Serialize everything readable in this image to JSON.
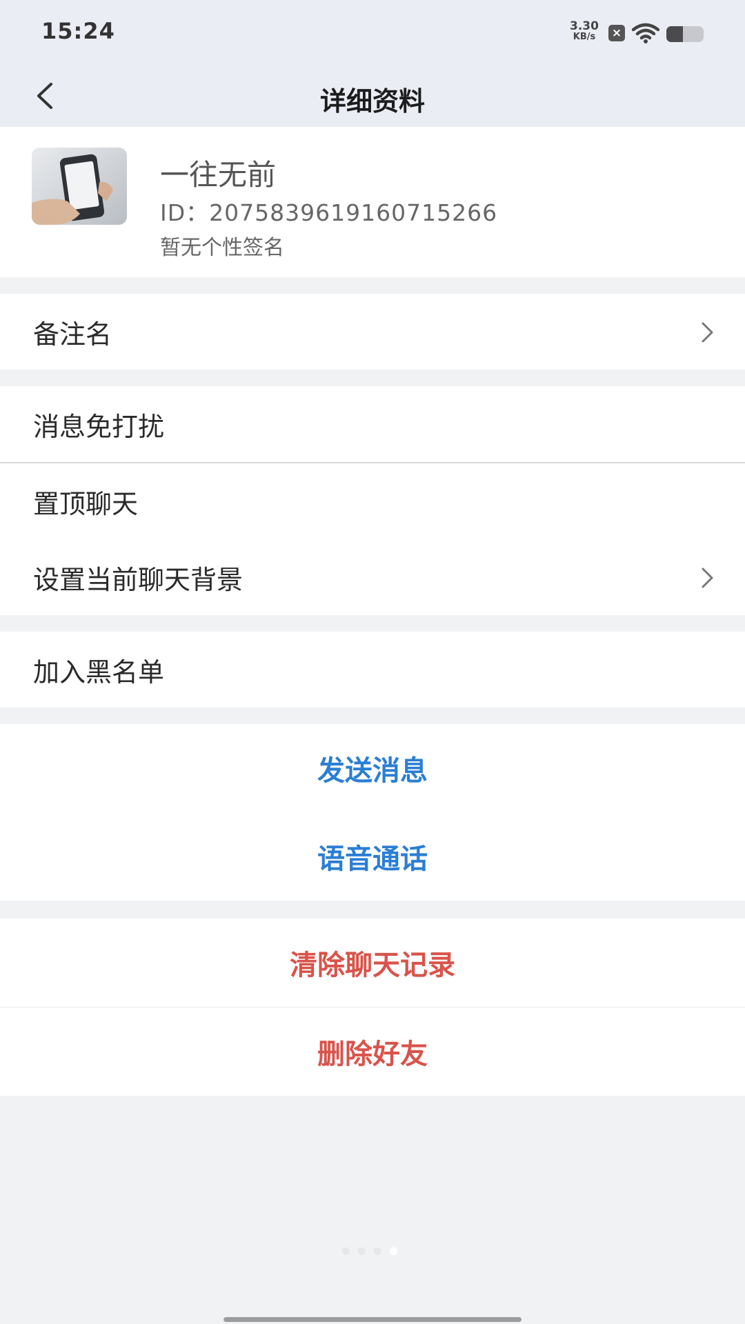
{
  "status_bar": {
    "time": "15:24",
    "net_speed_value": "3.30",
    "net_speed_unit": "KB/s",
    "notification_icon": "x-box-icon",
    "wifi_icon": "wifi-icon",
    "battery_icon": "battery-icon",
    "battery_level": 0.45
  },
  "nav": {
    "back_icon": "chevron-left-icon",
    "title": "详细资料"
  },
  "profile": {
    "name": "一往无前",
    "id_line": "ID：2075839619160715266",
    "signature": "暂无个性签名"
  },
  "settings": {
    "remark": "备注名",
    "mute": "消息免打扰",
    "pin_chat": "置顶聊天",
    "chat_background": "设置当前聊天背景",
    "blacklist": "加入黑名单"
  },
  "actions": {
    "send_message": "发送消息",
    "voice_call": "语音通话",
    "clear_history": "清除聊天记录",
    "delete_friend": "删除好友"
  },
  "colors": {
    "accent_blue": "#2b7ed4",
    "danger_red": "#d9534a",
    "header_bg": "#eaedf4",
    "page_bg": "#f1f2f4"
  },
  "pager": {
    "count": 4,
    "active_index": 3
  }
}
